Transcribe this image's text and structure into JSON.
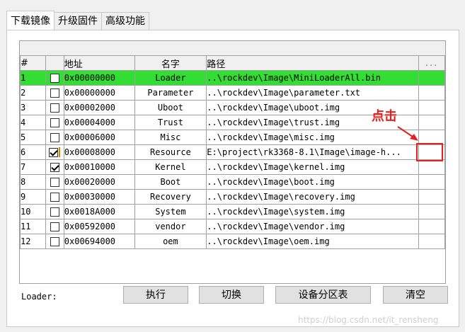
{
  "tabs": [
    {
      "label": "下载镜像",
      "active": true
    },
    {
      "label": "升级固件",
      "active": false
    },
    {
      "label": "高级功能",
      "active": false
    }
  ],
  "table": {
    "headers": {
      "num": "#",
      "addr": "地址",
      "name": "名字",
      "path": "路径",
      "more": "..."
    },
    "rows": [
      {
        "num": "1",
        "checked": false,
        "addr": "0x00000000",
        "name": "Loader",
        "path": "..\\rockdev\\Image\\MiniLoaderAll.bin",
        "selected": true
      },
      {
        "num": "2",
        "checked": false,
        "addr": "0x00000000",
        "name": "Parameter",
        "path": "..\\rockdev\\Image\\parameter.txt"
      },
      {
        "num": "3",
        "checked": false,
        "addr": "0x00002000",
        "name": "Uboot",
        "path": "..\\rockdev\\Image\\uboot.img"
      },
      {
        "num": "4",
        "checked": false,
        "addr": "0x00004000",
        "name": "Trust",
        "path": "..\\rockdev\\Image\\trust.img"
      },
      {
        "num": "5",
        "checked": false,
        "addr": "0x00006000",
        "name": "Misc",
        "path": "..\\rockdev\\Image\\misc.img"
      },
      {
        "num": "6",
        "checked": true,
        "addr": "0x00008000",
        "name": "Resource",
        "path": "E:\\project\\rk3368-8.1\\Image\\image-h...",
        "focused": true
      },
      {
        "num": "7",
        "checked": true,
        "addr": "0x00010000",
        "name": "Kernel",
        "path": "..\\rockdev\\Image\\kernel.img"
      },
      {
        "num": "8",
        "checked": false,
        "addr": "0x00020000",
        "name": "Boot",
        "path": "..\\rockdev\\Image\\boot.img"
      },
      {
        "num": "9",
        "checked": false,
        "addr": "0x00030000",
        "name": "Recovery",
        "path": "..\\rockdev\\Image\\recovery.img"
      },
      {
        "num": "10",
        "checked": false,
        "addr": "0x0018A000",
        "name": "System",
        "path": "..\\rockdev\\Image\\system.img"
      },
      {
        "num": "11",
        "checked": false,
        "addr": "0x00592000",
        "name": "vendor",
        "path": "..\\rockdev\\Image\\vendor.img"
      },
      {
        "num": "12",
        "checked": false,
        "addr": "0x00694000",
        "name": "oem",
        "path": "..\\rockdev\\Image\\oem.img"
      }
    ]
  },
  "annotation": {
    "text": "点击",
    "color": "#e62020"
  },
  "bottom": {
    "loader_label": "Loader:",
    "buttons": {
      "execute": "执行",
      "switch": "切换",
      "partition_table": "设备分区表",
      "clear": "清空"
    }
  },
  "watermark": "https://blog.csdn.net/it_rensheng",
  "colors": {
    "selected_row": "#33dd33",
    "annotation": "#e62020"
  }
}
